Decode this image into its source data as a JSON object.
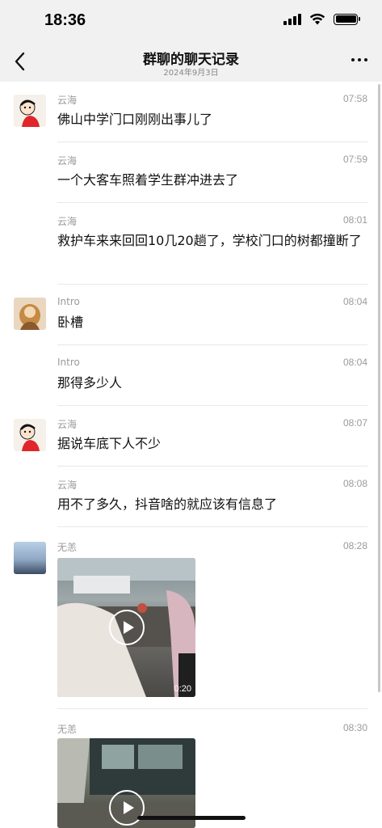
{
  "status_bar": {
    "time": "18:36"
  },
  "nav": {
    "title": "群聊的聊天记录",
    "subtitle": "2024年9月3日",
    "back_icon": "chevron-left-icon",
    "more_icon": "more-icon"
  },
  "messages": [
    {
      "sender": "云海",
      "time": "07:58",
      "text": "佛山中学门口刚刚出事儿了",
      "avatar": "avatar-yunhai"
    },
    {
      "sender": "云海",
      "time": "07:59",
      "text": "一个大客车照着学生群冲进去了"
    },
    {
      "sender": "云海",
      "time": "08:01",
      "text": "救护车来来回回10几20趟了，学校门口的树都撞断了"
    },
    {
      "sender": "Intro",
      "time": "08:04",
      "text": "卧槽",
      "avatar": "avatar-intro"
    },
    {
      "sender": "Intro",
      "time": "08:04",
      "text": "那得多少人"
    },
    {
      "sender": "云海",
      "time": "08:07",
      "text": "据说车底下人不少",
      "avatar": "avatar-yunhai"
    },
    {
      "sender": "云海",
      "time": "08:08",
      "text": "用不了多久，抖音啥的就应该有信息了"
    },
    {
      "sender": "无恙",
      "time": "08:28",
      "video_duration": "0:20",
      "avatar": "avatar-wuyang"
    },
    {
      "sender": "无恙",
      "time": "08:30"
    }
  ]
}
